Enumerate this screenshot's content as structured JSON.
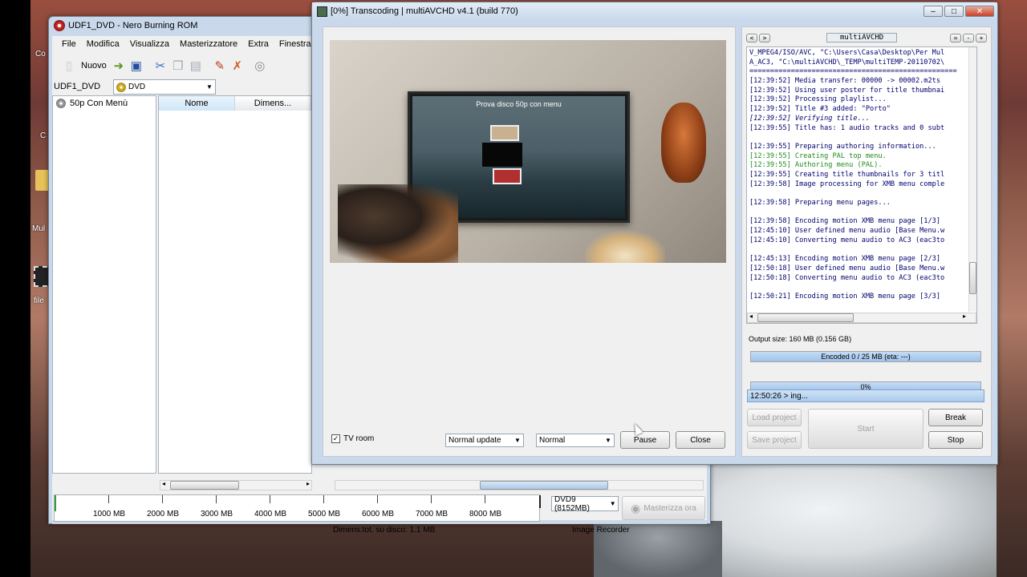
{
  "desktop": {
    "icon_labels": [
      "Co",
      "C",
      "Mul",
      "file"
    ]
  },
  "nero": {
    "title": "UDF1_DVD - Nero Burning ROM",
    "menu": [
      "File",
      "Modifica",
      "Visualizza",
      "Masterizzatore",
      "Extra",
      "Finestra",
      "?"
    ],
    "toolbar": {
      "new_label": "Nuovo"
    },
    "disc_name": "UDF1_DVD",
    "disc_type": "DVD",
    "tree_item": "50p Con Menù",
    "columns": [
      "Nome",
      "Dimens..."
    ],
    "capacity_ticks": [
      "1000 MB",
      "2000 MB",
      "3000 MB",
      "4000 MB",
      "5000 MB",
      "6000 MB",
      "7000 MB",
      "8000 MB"
    ],
    "disc_select": "DVD9 (8152MB)",
    "burn_button": "Masterizza ora",
    "status_size": "Dimens.tot. su disco: 1.1 MB",
    "status_recorder": "Image Recorder"
  },
  "mav": {
    "title": "[0%] Transcoding | multiAVCHD v4.1 (build 770)",
    "preview_title": "Prova disco 50p con menu",
    "tv_room_label": "TV room",
    "update_mode": "Normal update",
    "quality_mode": "Normal",
    "pause_label": "Pause",
    "close_label": "Close",
    "log_header": "multiAVCHD",
    "log_nav": [
      "<",
      ">"
    ],
    "log_tools": [
      "=",
      "-",
      "+"
    ],
    "log_lines": [
      {
        "text": "V_MPEG4/ISO/AVC, \"C:\\Users\\Casa\\Desktop\\Per Mul",
        "color": "#00006e"
      },
      {
        "text": "A_AC3, \"C:\\multiAVCHD\\_TEMP\\multiTEMP-20110702\\",
        "color": "#00006e"
      },
      {
        "text": "==================================================",
        "color": "#00006e"
      },
      {
        "text": "[12:39:52] Media transfer: 00000 -> 00002.m2ts",
        "color": "#00006e"
      },
      {
        "text": "[12:39:52] Using user poster for title thumbnai",
        "color": "#00006e"
      },
      {
        "text": "[12:39:52] Processing playlist...",
        "color": "#00006e"
      },
      {
        "text": "[12:39:52] Title #3 added: \"Porto\"",
        "color": "#00006e"
      },
      {
        "text": "[12:39:52] Verifying title...",
        "color": "#00006e",
        "italic": true
      },
      {
        "text": "[12:39:55] Title has: 1 audio tracks and 0 subt",
        "color": "#00006e"
      },
      {
        "text": "",
        "color": "#00006e"
      },
      {
        "text": "[12:39:55] Preparing authoring information...",
        "color": "#00006e"
      },
      {
        "text": "[12:39:55] Creating PAL top menu.",
        "color": "#1f8a1f"
      },
      {
        "text": "[12:39:55] Authoring menu (PAL).",
        "color": "#1f8a1f"
      },
      {
        "text": "[12:39:55] Creating title thumbnails for 3 titl",
        "color": "#00006e"
      },
      {
        "text": "[12:39:58] Image processing for XMB menu comple",
        "color": "#00006e"
      },
      {
        "text": "",
        "color": "#00006e"
      },
      {
        "text": "[12:39:58] Preparing menu pages...",
        "color": "#00006e"
      },
      {
        "text": "",
        "color": "#00006e"
      },
      {
        "text": "[12:39:58] Encoding motion XMB menu page [1/3]",
        "color": "#00006e"
      },
      {
        "text": "[12:45:10] User defined menu audio [Base Menu.w",
        "color": "#00006e"
      },
      {
        "text": "[12:45:10] Converting menu audio to AC3 (eac3to",
        "color": "#00006e"
      },
      {
        "text": "",
        "color": "#00006e"
      },
      {
        "text": "[12:45:13] Encoding motion XMB menu page [2/3]",
        "color": "#00006e"
      },
      {
        "text": "[12:50:18] User defined menu audio [Base Menu.w",
        "color": "#00006e"
      },
      {
        "text": "[12:50:18] Converting menu audio to AC3 (eac3to",
        "color": "#00006e"
      },
      {
        "text": "",
        "color": "#00006e"
      },
      {
        "text": "[12:50:21] Encoding motion XMB menu page [3/3]",
        "color": "#00006e"
      }
    ],
    "output_size": "Output size: 160 MB (0.156 GB)",
    "encoded_label": "Encoded 0 / 25 MB (eta:  ---)",
    "percent_label": "0%",
    "encoded_fraction": 1.0,
    "percent_fraction": 1.0,
    "status_line": "12:50:26 > ing...",
    "load_project": "Load project",
    "save_project": "Save project",
    "start_label": "Start",
    "break_label": "Break",
    "stop_label": "Stop"
  }
}
